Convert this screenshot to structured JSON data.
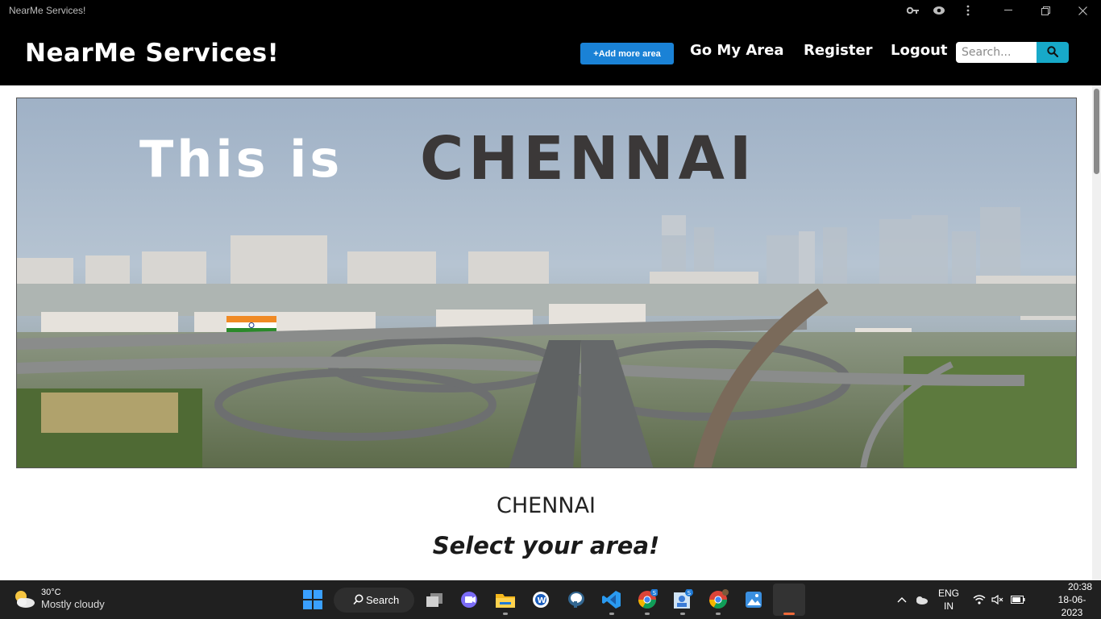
{
  "window": {
    "title": "NearMe Services!",
    "controls": [
      "minimize",
      "restore",
      "close"
    ]
  },
  "navbar": {
    "brand": "NearMe Services!",
    "add_area_label": "+Add more area",
    "links": [
      "Go My Area",
      "Register",
      "Logout"
    ],
    "search_placeholder": "Search...",
    "search_button_icon": "search-icon",
    "accent_color": "#1a82d6",
    "search_button_color": "#17a9c9"
  },
  "banner": {
    "heading_prefix": "This is",
    "heading_city": "CHENNAI"
  },
  "main": {
    "city_name": "CHENNAI",
    "prompt": "Select your area!"
  },
  "taskbar": {
    "weather_temp": "30°C",
    "weather_desc": "Mostly cloudy",
    "search_label": "Search",
    "language_line1": "ENG",
    "language_line2": "IN",
    "time": "20:38",
    "date": "18-06-2023",
    "apps": [
      "windows-start-icon",
      "task-view-icon",
      "meet-icon",
      "file-explorer-icon",
      "word-app-icon",
      "postgres-icon",
      "vscode-icon",
      "chrome-icon",
      "people-app-icon",
      "chrome-icon",
      "photos-icon",
      "active-app-icon"
    ]
  }
}
